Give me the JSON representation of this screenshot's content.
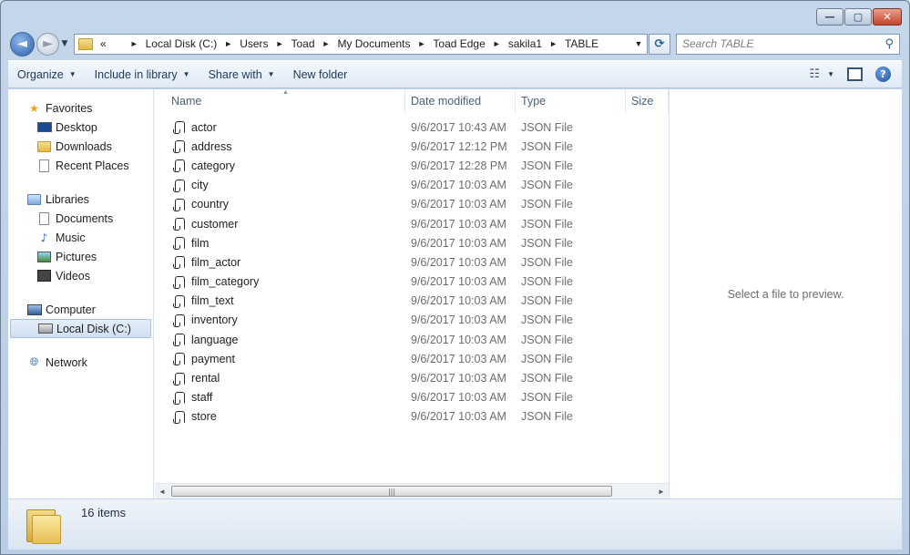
{
  "window": {
    "buttons": {
      "minimize": "—",
      "maximize": "▢",
      "close": "✕"
    }
  },
  "address_bar": {
    "overflow": "«",
    "crumbs": [
      "Local Disk (C:)",
      "Users",
      "Toad",
      "My Documents",
      "Toad Edge",
      "sakila1",
      "TABLE"
    ],
    "separator": "►",
    "dropdown": "▼",
    "refresh": "⟳"
  },
  "search": {
    "placeholder": "Search TABLE",
    "icon": "search-icon"
  },
  "toolbar": {
    "organize": "Organize",
    "include_in_library": "Include in library",
    "share_with": "Share with",
    "new_folder": "New folder",
    "dropdown_arrow": "▼",
    "views_icon": "☷",
    "views_arrow": "▼",
    "help": "?"
  },
  "nav": {
    "favorites": {
      "label": "Favorites",
      "items": [
        "Desktop",
        "Downloads",
        "Recent Places"
      ]
    },
    "libraries": {
      "label": "Libraries",
      "items": [
        "Documents",
        "Music",
        "Pictures",
        "Videos"
      ]
    },
    "computer": {
      "label": "Computer",
      "items": [
        "Local Disk (C:)"
      ]
    },
    "network": {
      "label": "Network"
    }
  },
  "columns": {
    "name": "Name",
    "date": "Date modified",
    "type": "Type",
    "size": "Size",
    "sort_indicator": "▲"
  },
  "files": [
    {
      "name": "actor",
      "date": "9/6/2017 10:43 AM",
      "type": "JSON File"
    },
    {
      "name": "address",
      "date": "9/6/2017 12:12 PM",
      "type": "JSON File"
    },
    {
      "name": "category",
      "date": "9/6/2017 12:28 PM",
      "type": "JSON File"
    },
    {
      "name": "city",
      "date": "9/6/2017 10:03 AM",
      "type": "JSON File"
    },
    {
      "name": "country",
      "date": "9/6/2017 10:03 AM",
      "type": "JSON File"
    },
    {
      "name": "customer",
      "date": "9/6/2017 10:03 AM",
      "type": "JSON File"
    },
    {
      "name": "film",
      "date": "9/6/2017 10:03 AM",
      "type": "JSON File"
    },
    {
      "name": "film_actor",
      "date": "9/6/2017 10:03 AM",
      "type": "JSON File"
    },
    {
      "name": "film_category",
      "date": "9/6/2017 10:03 AM",
      "type": "JSON File"
    },
    {
      "name": "film_text",
      "date": "9/6/2017 10:03 AM",
      "type": "JSON File"
    },
    {
      "name": "inventory",
      "date": "9/6/2017 10:03 AM",
      "type": "JSON File"
    },
    {
      "name": "language",
      "date": "9/6/2017 10:03 AM",
      "type": "JSON File"
    },
    {
      "name": "payment",
      "date": "9/6/2017 10:03 AM",
      "type": "JSON File"
    },
    {
      "name": "rental",
      "date": "9/6/2017 10:03 AM",
      "type": "JSON File"
    },
    {
      "name": "staff",
      "date": "9/6/2017 10:03 AM",
      "type": "JSON File"
    },
    {
      "name": "store",
      "date": "9/6/2017 10:03 AM",
      "type": "JSON File"
    }
  ],
  "scrollbar": {
    "left": "◄",
    "right": "►",
    "grip": "|||"
  },
  "preview": {
    "message": "Select a file to preview."
  },
  "status": {
    "item_count": "16 items"
  }
}
